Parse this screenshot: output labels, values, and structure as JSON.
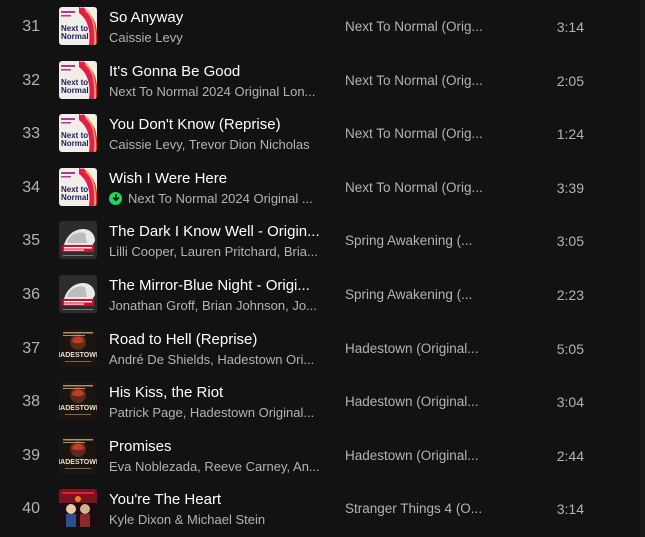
{
  "tracks": [
    {
      "number": "31",
      "title": "So Anyway",
      "artist": "Caissie Levy",
      "album": "Next To Normal (Orig...",
      "duration": "3:14",
      "art": "next-to-normal",
      "downloaded": false
    },
    {
      "number": "32",
      "title": "It's Gonna Be Good",
      "artist": "Next To Normal 2024 Original Lon...",
      "album": "Next To Normal (Orig...",
      "duration": "2:05",
      "art": "next-to-normal",
      "downloaded": false
    },
    {
      "number": "33",
      "title": "You Don't Know (Reprise)",
      "artist": "Caissie Levy, Trevor Dion Nicholas",
      "album": "Next To Normal (Orig...",
      "duration": "1:24",
      "art": "next-to-normal",
      "downloaded": false
    },
    {
      "number": "34",
      "title": "Wish I Were Here",
      "artist": "Next To Normal 2024 Original ...",
      "album": "Next To Normal (Orig...",
      "duration": "3:39",
      "art": "next-to-normal",
      "downloaded": true
    },
    {
      "number": "35",
      "title": "The Dark I Know Well - Origin...",
      "artist": "Lilli Cooper, Lauren Pritchard, Bria...",
      "album": "Spring Awakening (...",
      "duration": "3:05",
      "art": "spring-awakening",
      "downloaded": false
    },
    {
      "number": "36",
      "title": "The Mirror-Blue Night - Origi...",
      "artist": "Jonathan Groff, Brian Johnson, Jo...",
      "album": "Spring Awakening (...",
      "duration": "2:23",
      "art": "spring-awakening",
      "downloaded": false
    },
    {
      "number": "37",
      "title": "Road to Hell (Reprise)",
      "artist": "André De Shields, Hadestown Ori...",
      "album": "Hadestown (Original...",
      "duration": "5:05",
      "art": "hadestown",
      "downloaded": false
    },
    {
      "number": "38",
      "title": "His Kiss, the Riot",
      "artist": "Patrick Page, Hadestown Original...",
      "album": "Hadestown (Original...",
      "duration": "3:04",
      "art": "hadestown",
      "downloaded": false
    },
    {
      "number": "39",
      "title": "Promises",
      "artist": "Eva Noblezada, Reeve Carney, An...",
      "album": "Hadestown (Original...",
      "duration": "2:44",
      "art": "hadestown",
      "downloaded": false
    },
    {
      "number": "40",
      "title": "You're The Heart",
      "artist": "Kyle Dixon & Michael Stein",
      "album": "Stranger Things 4 (O...",
      "duration": "3:14",
      "art": "stranger-things",
      "downloaded": false
    }
  ],
  "art_labels": {
    "next-to-normal": {
      "line1": "Next to",
      "line2": "Normal"
    },
    "hadestown": {
      "line1": "HADESTOWN"
    }
  },
  "colors": {
    "background": "#121212",
    "primary_text": "#ffffff",
    "secondary_text": "#b3b3b3",
    "download_green": "#1ed760"
  }
}
